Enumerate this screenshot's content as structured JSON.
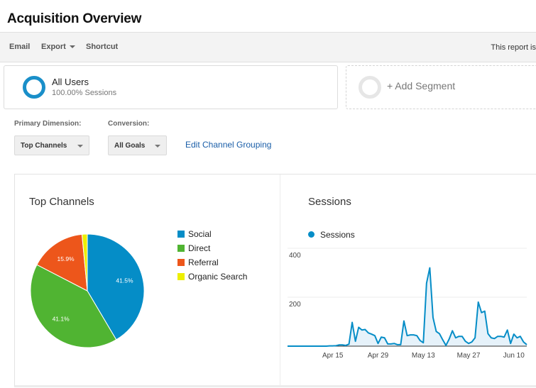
{
  "header": {
    "title": "Acquisition Overview"
  },
  "toolbar": {
    "email_label": "Email",
    "export_label": "Export",
    "shortcut_label": "Shortcut",
    "right_text": "This report is"
  },
  "segments": {
    "all_users": {
      "title": "All Users",
      "subtitle": "100.00% Sessions",
      "color": "#1a8fc9"
    },
    "add_segment_label": "+ Add Segment"
  },
  "controls": {
    "primary_dimension_label": "Primary Dimension:",
    "primary_dimension_value": "Top Channels",
    "conversion_label": "Conversion:",
    "conversion_value": "All Goals",
    "edit_link": "Edit Channel Grouping"
  },
  "chart_data": [
    {
      "type": "pie",
      "title": "Top Channels",
      "legend_position": "right",
      "categories": [
        "Social",
        "Direct",
        "Referral",
        "Organic Search"
      ],
      "values": [
        41.5,
        41.1,
        15.9,
        1.5
      ],
      "data_labels": [
        "41.5%",
        "41.1%",
        "15.9%",
        ""
      ],
      "colors": [
        "#058dc7",
        "#50b432",
        "#ed561b",
        "#edef00"
      ]
    },
    {
      "type": "area",
      "title": "Sessions",
      "legend": [
        "Sessions"
      ],
      "legend_position": "top-left",
      "color": "#058dc7",
      "fill_color": "#e6f2fa",
      "x_start": "Apr 1",
      "x_ticks": [
        "Apr 15",
        "Apr 29",
        "May 13",
        "May 27",
        "Jun 10"
      ],
      "x_tick_days": [
        14,
        28,
        42,
        56,
        70
      ],
      "y_ticks": [
        200,
        400
      ],
      "ylim": [
        0,
        400
      ],
      "grid": true,
      "values": [
        0,
        0,
        0,
        0,
        0,
        0,
        0,
        0,
        0,
        0,
        0,
        0,
        0,
        1,
        1,
        2,
        5,
        5,
        3,
        8,
        97,
        20,
        77,
        66,
        68,
        54,
        49,
        43,
        11,
        37,
        34,
        9,
        9,
        11,
        6,
        6,
        103,
        43,
        46,
        46,
        43,
        23,
        14,
        257,
        320,
        117,
        60,
        51,
        26,
        3,
        29,
        63,
        34,
        40,
        40,
        20,
        11,
        17,
        34,
        180,
        137,
        143,
        51,
        34,
        31,
        40,
        40,
        37,
        66,
        11,
        49,
        34,
        40,
        17,
        6
      ]
    }
  ]
}
